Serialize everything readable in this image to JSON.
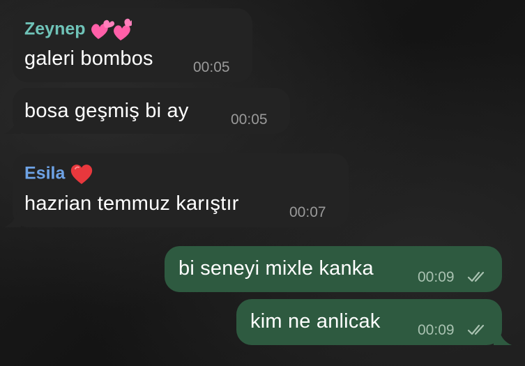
{
  "messages": [
    {
      "sender": "Zeynep",
      "sender_emoji": "💕💕",
      "text": "galeri bombos",
      "time": "00:05"
    },
    {
      "text": "bosa geşmiş bi ay",
      "time": "00:05"
    },
    {
      "sender": "Esila",
      "sender_emoji": "❤️",
      "text": "hazrian temmuz karıştır",
      "time": "00:07"
    },
    {
      "text": "bi seneyi mixle kanka",
      "time": "00:09",
      "status": "read"
    },
    {
      "text": "kim ne anlicak",
      "time": "00:09",
      "status": "read"
    }
  ],
  "colors": {
    "incoming_bubble": "#232323",
    "outgoing_bubble": "#2e5a40",
    "sender_zeynep": "#6fc3b8",
    "sender_esila": "#6ea3e6"
  }
}
